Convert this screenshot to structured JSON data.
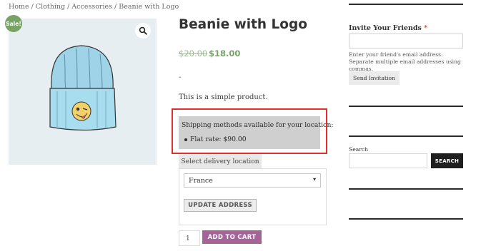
{
  "breadcrumb": "Home / Clothing / Accessories / Beanie with Logo",
  "product": {
    "sale_badge": "Sale!",
    "title": "Beanie with Logo",
    "price_old": "$20.00",
    "price_new": "$18.00",
    "dash": "-",
    "description": "This is a simple product."
  },
  "shipping": {
    "title": "Shipping methods available for your location:",
    "methods": [
      "Flat rate: $90.00"
    ]
  },
  "calculator": {
    "tab_label": "Select delivery location",
    "country": "France",
    "update_button": "UPDATE ADDRESS"
  },
  "cart": {
    "quantity": "1",
    "add_button": "ADD TO CART"
  },
  "sidebar": {
    "invite_title": "Invite Your Friends",
    "required_mark": "*",
    "invite_help": "Enter your friend's email address. Separate multiple email addresses using commas.",
    "send_button": "Send Invitation",
    "search_label": "Search",
    "search_button": "SEARCH"
  },
  "icons": {
    "zoom": "magnifier-icon",
    "select_chevron": "chevron-down-icon"
  },
  "colors": {
    "sale_green": "#77a464",
    "add_to_cart": "#a46497",
    "highlight_red": "#e32c2c",
    "search_button": "#1f1f1f"
  }
}
